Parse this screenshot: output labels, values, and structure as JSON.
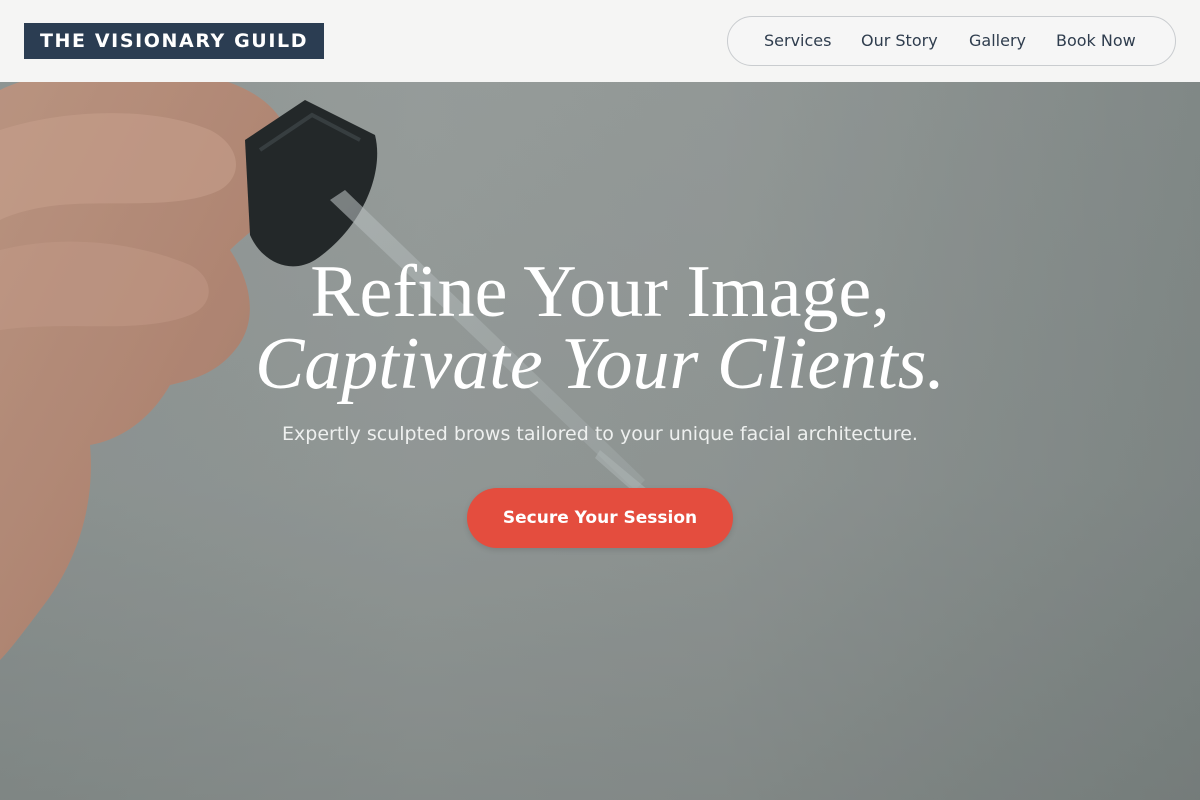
{
  "header": {
    "logo_text": "THE VISIONARY GUILD",
    "nav": [
      {
        "label": "Services"
      },
      {
        "label": "Our Story"
      },
      {
        "label": "Gallery"
      },
      {
        "label": "Book Now"
      }
    ]
  },
  "hero": {
    "headline_line1": "Refine Your Image,",
    "headline_line2": "Captivate Your Clients.",
    "subtitle": "Expertly sculpted brows tailored to your unique facial architecture.",
    "cta_label": "Secure Your Session"
  },
  "colors": {
    "logo_bg": "#2b3d52",
    "header_bg": "#f5f5f4",
    "cta_bg": "#e44d3e",
    "nav_text": "#2f3d4e"
  }
}
